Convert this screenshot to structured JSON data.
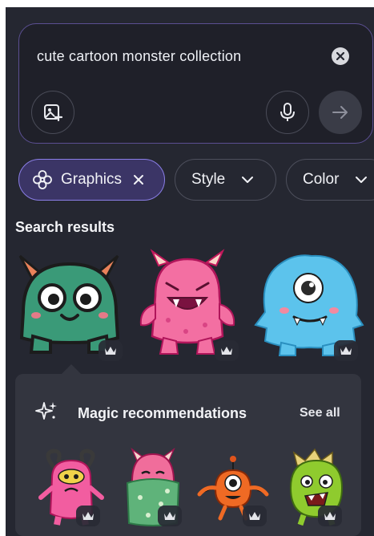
{
  "search": {
    "query": "cute cartoon monster collection",
    "clear_icon": "close-icon",
    "image_search_icon": "image-plus-icon",
    "voice_icon": "microphone-icon",
    "submit_icon": "arrow-right-icon"
  },
  "filters": [
    {
      "label": "Graphics",
      "icon": "flower-icon",
      "trailing_icon": "close-icon",
      "active": true
    },
    {
      "label": "Style",
      "trailing_icon": "chevron-down-icon",
      "active": false
    },
    {
      "label": "Color",
      "trailing_icon": "chevron-down-icon",
      "active": false
    }
  ],
  "results": {
    "title": "Search results",
    "items": [
      {
        "name": "green horned monster",
        "premium": true
      },
      {
        "name": "pink fanged monster",
        "premium": true
      },
      {
        "name": "blue furry cyclops monster",
        "premium": true
      }
    ]
  },
  "recommendations": {
    "title": "Magic recommendations",
    "see_all": "See all",
    "icon": "sparkles-icon",
    "items": [
      {
        "name": "pink curly-horned monster",
        "premium": true
      },
      {
        "name": "pink monster in green blanket",
        "premium": true
      },
      {
        "name": "orange one-eyed monster",
        "premium": true
      },
      {
        "name": "lime green spiky monster",
        "premium": true
      }
    ]
  },
  "colors": {
    "panel_bg": "#252731",
    "accent": "#8a7ee6",
    "active_chip_bg": "#3b3566"
  }
}
